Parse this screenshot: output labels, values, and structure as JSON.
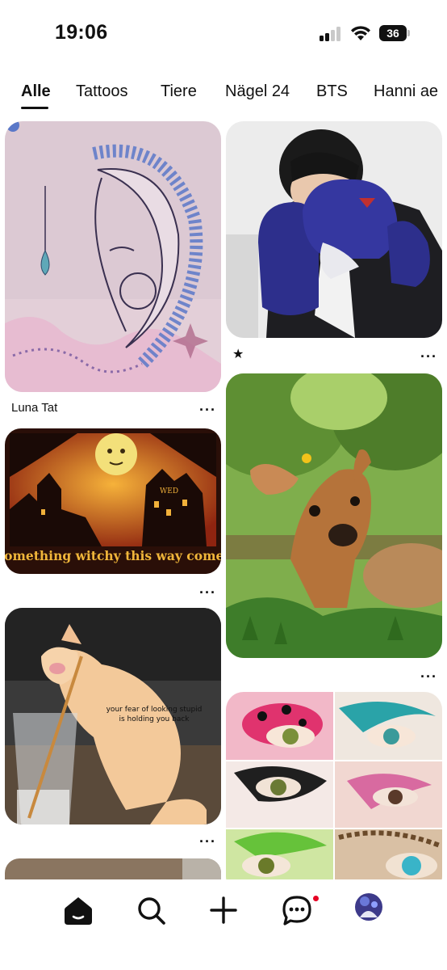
{
  "status_bar": {
    "time": "19:06",
    "battery": "36"
  },
  "tabs": [
    {
      "label": "Alle"
    },
    {
      "label": "Tattoos"
    },
    {
      "label": "Tiere"
    },
    {
      "label": "Nägel 24"
    },
    {
      "label": "BTS"
    },
    {
      "label": "Hanni ae"
    }
  ],
  "pins": {
    "moon_tattoo": {
      "caption": "Luna Tat",
      "more": "···"
    },
    "boxer": {
      "more": "···"
    },
    "witchy": {
      "text": "Something witchy this way comes",
      "sign": "WED",
      "more": "···"
    },
    "fawn": {
      "more": "···"
    },
    "kitten": {
      "quote_line1": "your fear of looking stupid",
      "quote_line2": "is holding you back",
      "more": "···"
    },
    "eye_makeup": {}
  },
  "icons": {
    "home": "home-icon",
    "search": "search-icon",
    "create": "plus-icon",
    "messages": "chat-icon",
    "profile": "avatar"
  },
  "colors": {
    "badge": "#e60023",
    "text": "#111111"
  }
}
